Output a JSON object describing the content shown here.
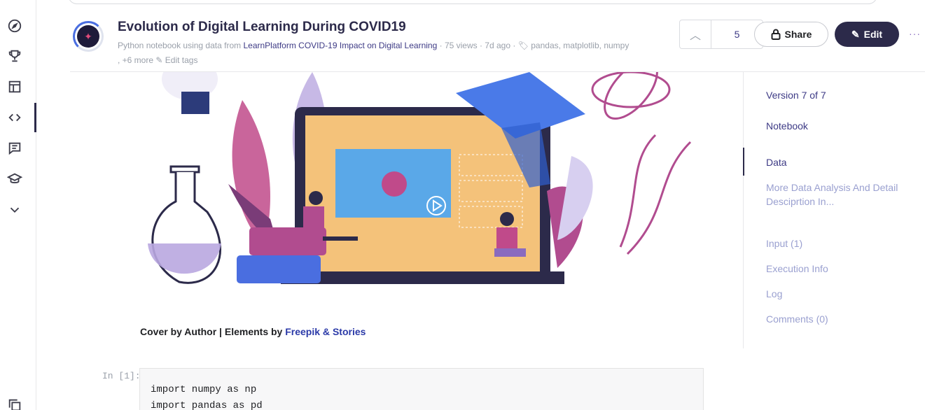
{
  "header": {
    "title": "Evolution of Digital Learning During COVID19",
    "meta_prefix": "Python notebook using data from",
    "meta_source_link": "LearnPlatform COVID-19 Impact on Digital Learning",
    "meta_views": "· 75 views · 7d ago ·",
    "meta_tags": "pandas, matplotlib, numpy",
    "meta_more_tags": ", +6 more",
    "edit_tags": "Edit tags",
    "vote_count": "5",
    "share_label": "Share",
    "edit_label": "Edit",
    "more_label": "···"
  },
  "sidebar": {
    "icons": [
      "compass-icon",
      "trophy-icon",
      "table-icon",
      "code-icon",
      "discussion-icon",
      "school-icon",
      "chevron-down-icon",
      "copy-icon"
    ]
  },
  "content": {
    "caption_prefix": "Cover by Author | Elements by",
    "caption_link1": "Freepik",
    "caption_amp": "&",
    "caption_link2": "Stories",
    "cell_label": "In [1]:",
    "code_lines": [
      "import numpy as np",
      "import pandas as pd"
    ]
  },
  "toc": {
    "version": "Version 7 of 7",
    "notebook": "Notebook",
    "data": "Data",
    "more_analysis": "More Data Analysis And Detail Desciprtion In...",
    "input": "Input (1)",
    "execution": "Execution Info",
    "log": "Log",
    "comments": "Comments (0)"
  },
  "colors": {
    "accent": "#2c2a4a",
    "link": "#3d3a85",
    "muted": "#9aa0aa"
  }
}
